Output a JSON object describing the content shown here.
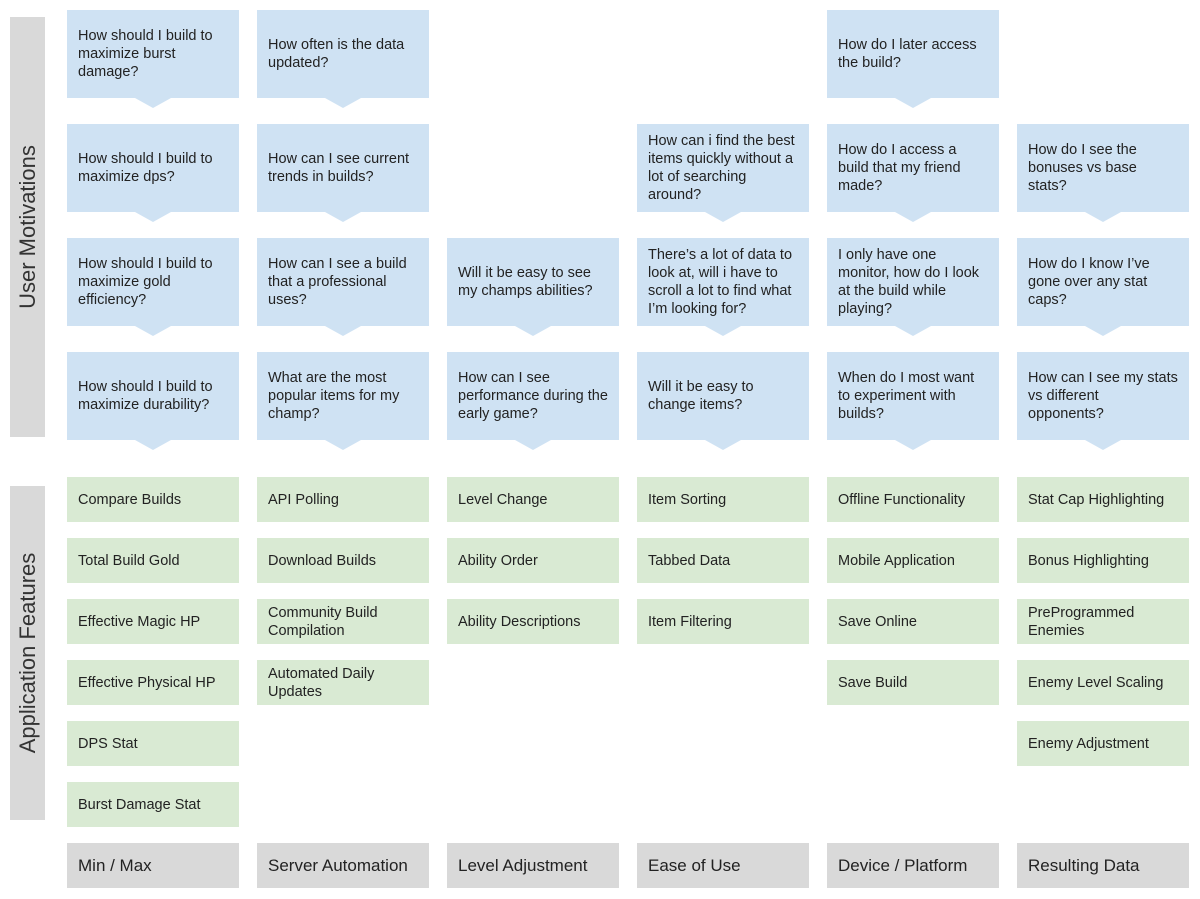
{
  "labels": {
    "user_motivations": "User Motivations",
    "application_features": "Application Features"
  },
  "colors": {
    "motivation": "#cfe2f3",
    "feature": "#d9ead3",
    "category": "#d9d9d9"
  },
  "columns": [
    {
      "category": "Min / Max",
      "motivations": [
        "How should I build to maximize burst damage?",
        "How should I build to maximize dps?",
        "How should I build to maximize gold efficiency?",
        "How should I build to maximize durability?"
      ],
      "features": [
        "Compare Builds",
        "Total Build Gold",
        "Effective Magic HP",
        "Effective Physical HP",
        "DPS Stat",
        "Burst Damage Stat"
      ]
    },
    {
      "category": "Server Automation",
      "motivations": [
        "How often is the data updated?",
        "How can I see current trends in builds?",
        "How can I see a build that a professional uses?",
        "What are the most popular items for my champ?"
      ],
      "features": [
        "API Polling",
        "Download Builds",
        "Community Build Compilation",
        "Automated Daily Updates"
      ]
    },
    {
      "category": "Level Adjustment",
      "motivations": [
        null,
        null,
        "Will it be easy to see my champs abilities?",
        "How can I see performance during the early game?"
      ],
      "features": [
        "Level Change",
        "Ability Order",
        "Ability Descriptions"
      ]
    },
    {
      "category": "Ease of Use",
      "motivations": [
        null,
        "How can i find the best items quickly without a lot of searching around?",
        "There’s a lot of data to look at, will i have to scroll a lot to find what I’m looking for?",
        "Will it be easy to change items?"
      ],
      "features": [
        "Item Sorting",
        "Tabbed Data",
        "Item Filtering"
      ]
    },
    {
      "category": "Device / Platform",
      "motivations": [
        "How do I later access the build?",
        "How do I access a build that my friend made?",
        "I only have one monitor, how do I look at the build while playing?",
        "When do I most want to experiment with builds?"
      ],
      "features": [
        "Offline Functionality",
        "Mobile Application",
        "Save Online",
        "Save Build"
      ]
    },
    {
      "category": "Resulting Data",
      "motivations": [
        null,
        "How do I see the bonuses vs base stats?",
        "How do I know I’ve gone over any stat caps?",
        "How can I see my stats vs different opponents?"
      ],
      "features": [
        "Stat Cap Highlighting",
        "Bonus Highlighting",
        "PreProgrammed Enemies",
        "Enemy Level Scaling",
        "Enemy Adjustment"
      ]
    }
  ]
}
